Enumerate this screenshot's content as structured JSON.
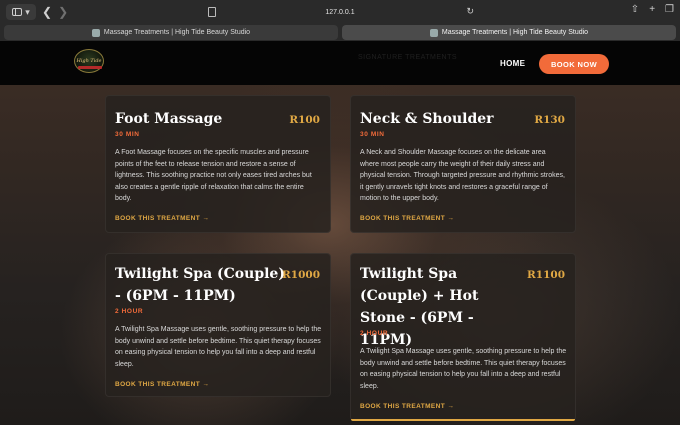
{
  "browser": {
    "url": "127.0.0.1",
    "tabs": [
      {
        "title": "Massage Treatments | High Tide Beauty Studio",
        "active": false
      },
      {
        "title": "Massage Treatments | High Tide Beauty Studio",
        "active": true
      }
    ]
  },
  "header": {
    "logo_text": "High Tide",
    "ghost_text": "SIGNATURE TREATMENTS",
    "nav_home": "HOME",
    "book_button": "BOOK NOW",
    "accent_color": "#f26b3a"
  },
  "cards": [
    {
      "title": "Foot Massage",
      "price": "R100",
      "duration": "30 MIN",
      "description": "A Foot Massage focuses on the specific muscles and pressure points of the feet to release tension and restore a sense of lightness. This soothing practice not only eases tired arches but also creates a gentle ripple of relaxation that calms the entire body.",
      "link": "BOOK THIS TREATMENT →"
    },
    {
      "title": "Neck & Shoulder",
      "price": "R130",
      "duration": "30 MIN",
      "description": "A Neck and Shoulder Massage focuses on the delicate area where most people carry the weight of their daily stress and physical tension. Through targeted pressure and rhythmic strokes, it gently unravels tight knots and restores a graceful range of motion to the upper body.",
      "link": "BOOK THIS TREATMENT →"
    },
    {
      "title": "Twilight Spa (Couple) - (6PM - 11PM)",
      "price": "R1000",
      "duration": "2 HOUR",
      "description": "A Twilight Spa Massage uses gentle, soothing pressure to help the body unwind and settle before bedtime. This quiet therapy focuses on easing physical tension to help you fall into a deep and restful sleep.",
      "link": "BOOK THIS TREATMENT →"
    },
    {
      "title": "Twilight Spa (Couple) + Hot Stone - (6PM - 11PM)",
      "price": "R1100",
      "duration": "2 HOUR",
      "description": "A Twilight Spa Massage uses gentle, soothing pressure to help the body unwind and settle before bedtime. This quiet therapy focuses on easing physical tension to help you fall into a deep and restful sleep.",
      "link": "BOOK THIS TREATMENT →"
    }
  ],
  "colors": {
    "price": "#e0a844",
    "duration": "#f26b3a",
    "card_bg": "#26221e"
  }
}
